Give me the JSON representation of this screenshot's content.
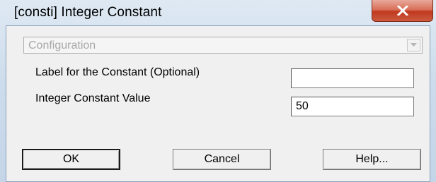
{
  "window": {
    "title": "[consti] Integer Constant",
    "close_icon": "close-x-icon"
  },
  "config": {
    "selected": "Configuration",
    "arrow_icon": "chevron-down-icon"
  },
  "fields": {
    "label_constant": {
      "label": "Label for the Constant (Optional)",
      "value": ""
    },
    "integer_value": {
      "label": "Integer Constant Value",
      "value": "50"
    }
  },
  "buttons": {
    "ok": "OK",
    "cancel": "Cancel",
    "help": "Help..."
  }
}
